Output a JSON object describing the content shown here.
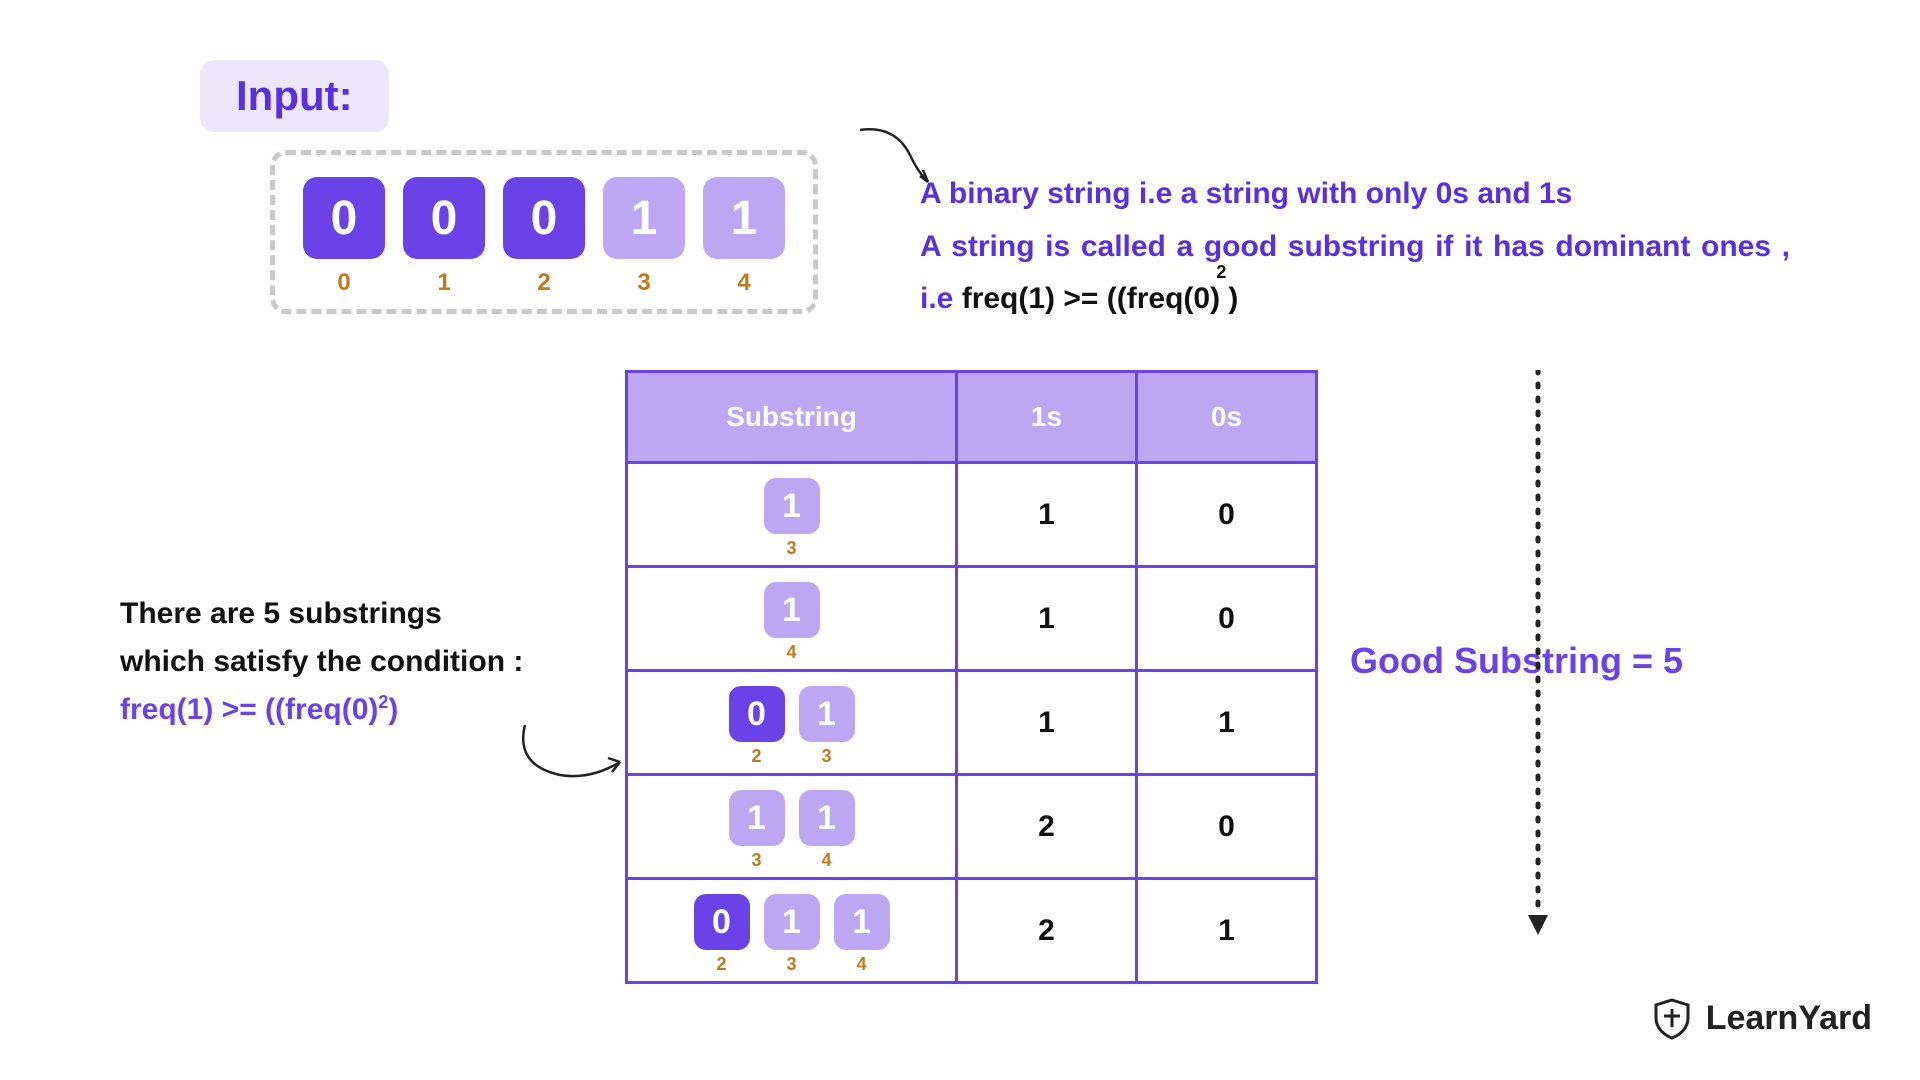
{
  "input_label": "Input:",
  "array": [
    {
      "value": "0",
      "index": "0",
      "kind": "zero"
    },
    {
      "value": "0",
      "index": "1",
      "kind": "zero"
    },
    {
      "value": "0",
      "index": "2",
      "kind": "zero"
    },
    {
      "value": "1",
      "index": "3",
      "kind": "one"
    },
    {
      "value": "1",
      "index": "4",
      "kind": "one"
    }
  ],
  "description": {
    "line1": "A binary string i.e a string with only 0s and 1s",
    "line2_pre": "A string is called a good substring if it has dominant ones , i.e ",
    "formula_text": "freq(1) >= ((freq(0) )",
    "formula_sup": "2"
  },
  "table": {
    "headers": {
      "sub": "Substring",
      "ones": "1s",
      "zeros": "0s"
    },
    "rows": [
      {
        "digits": [
          {
            "v": "1",
            "k": "one",
            "i": "3"
          }
        ],
        "ones": "1",
        "zeros": "0"
      },
      {
        "digits": [
          {
            "v": "1",
            "k": "one",
            "i": "4"
          }
        ],
        "ones": "1",
        "zeros": "0"
      },
      {
        "digits": [
          {
            "v": "0",
            "k": "zero",
            "i": "2"
          },
          {
            "v": "1",
            "k": "one",
            "i": "3"
          }
        ],
        "ones": "1",
        "zeros": "1"
      },
      {
        "digits": [
          {
            "v": "1",
            "k": "one",
            "i": "3"
          },
          {
            "v": "1",
            "k": "one",
            "i": "4"
          }
        ],
        "ones": "2",
        "zeros": "0"
      },
      {
        "digits": [
          {
            "v": "0",
            "k": "zero",
            "i": "2"
          },
          {
            "v": "1",
            "k": "one",
            "i": "3"
          },
          {
            "v": "1",
            "k": "one",
            "i": "4"
          }
        ],
        "ones": "2",
        "zeros": "1"
      }
    ]
  },
  "explanation": {
    "line1": "There are 5 substrings",
    "line2": "which satisfy the condition :",
    "cond_text": "freq(1) >= ((freq(0)",
    "cond_sup": "2",
    "cond_close": ")"
  },
  "result": "Good Substring = 5",
  "brand": "LearnYard"
}
